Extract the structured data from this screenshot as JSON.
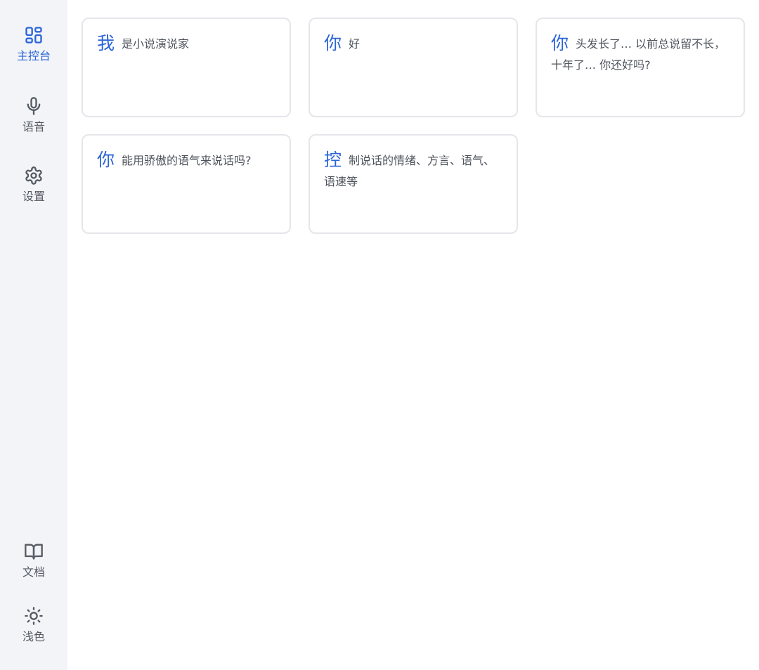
{
  "sidebar": {
    "colors": {
      "active": "#2b64d8",
      "inactive": "#555a63",
      "background": "#f2f4f7"
    },
    "items": [
      {
        "label": "主控台",
        "icon": "dashboard-grid-icon",
        "active": true
      },
      {
        "label": "语音",
        "icon": "microphone-icon",
        "active": false
      },
      {
        "label": "设置",
        "icon": "gear-icon",
        "active": false
      }
    ],
    "bottom_items": [
      {
        "label": "文档",
        "icon": "book-icon"
      },
      {
        "label": "浅色",
        "icon": "sun-icon"
      }
    ]
  },
  "cards": [
    {
      "lead": "我",
      "text": "是小说演说家"
    },
    {
      "lead": "你",
      "text": "好"
    },
    {
      "lead": "你",
      "text": "头发长了… 以前总说留不长，十年了… 你还好吗?"
    },
    {
      "lead": "你",
      "text": "能用骄傲的语气来说话吗?"
    },
    {
      "lead": "控",
      "text": "制说话的情绪、方言、语气、语速等"
    }
  ],
  "accent_color": "#2b64d8"
}
